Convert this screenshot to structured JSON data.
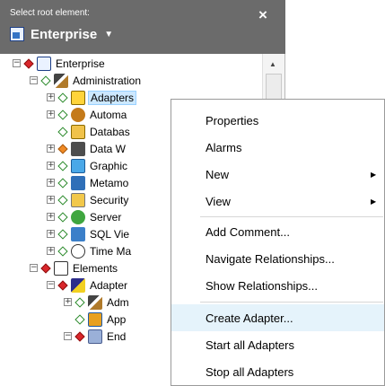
{
  "header": {
    "label": "Select root element:",
    "selected": "Enterprise",
    "close_glyph": "×",
    "caret_glyph": "▼"
  },
  "tree": {
    "root": "Enterprise",
    "items": [
      {
        "label": "Administration",
        "icon": "tools-icon"
      },
      {
        "label": "Adapters",
        "icon": "adapters-icon",
        "selected": true
      },
      {
        "label": "Automa",
        "icon": "automation-icon"
      },
      {
        "label": "Databas",
        "icon": "database-icon"
      },
      {
        "label": "Data W",
        "icon": "data-warehouse-icon"
      },
      {
        "label": "Graphic",
        "icon": "graphics-icon"
      },
      {
        "label": "Metamo",
        "icon": "metamodel-icon"
      },
      {
        "label": "Security",
        "icon": "security-icon"
      },
      {
        "label": "Server",
        "icon": "server-icon"
      },
      {
        "label": "SQL Vie",
        "icon": "sql-view-icon"
      },
      {
        "label": "Time Ma",
        "icon": "time-icon"
      },
      {
        "label": "Elements",
        "icon": "elements-icon"
      },
      {
        "label": "Adapter",
        "icon": "adapter-icon"
      },
      {
        "label": "Adm",
        "icon": "tools-icon"
      },
      {
        "label": "App",
        "icon": "application-icon"
      },
      {
        "label": "End",
        "icon": "endpoint-icon"
      }
    ]
  },
  "context_menu": {
    "items": [
      {
        "label": "Properties"
      },
      {
        "label": "Alarms"
      },
      {
        "label": "New",
        "submenu": true
      },
      {
        "label": "View",
        "submenu": true
      },
      {
        "label": "Add Comment..."
      },
      {
        "label": "Navigate Relationships..."
      },
      {
        "label": "Show Relationships..."
      },
      {
        "label": "Create Adapter...",
        "highlighted": true
      },
      {
        "label": "Start all Adapters"
      },
      {
        "label": "Stop all Adapters"
      }
    ],
    "submenu_glyph": "▶"
  },
  "colors": {
    "header_bg": "#6b6b6b",
    "selection_bg": "#cce8ff",
    "menu_hover_bg": "#e5f3fb",
    "status_green": "#2b8a2b",
    "status_red": "#d9262b",
    "status_orange": "#f08a24"
  }
}
